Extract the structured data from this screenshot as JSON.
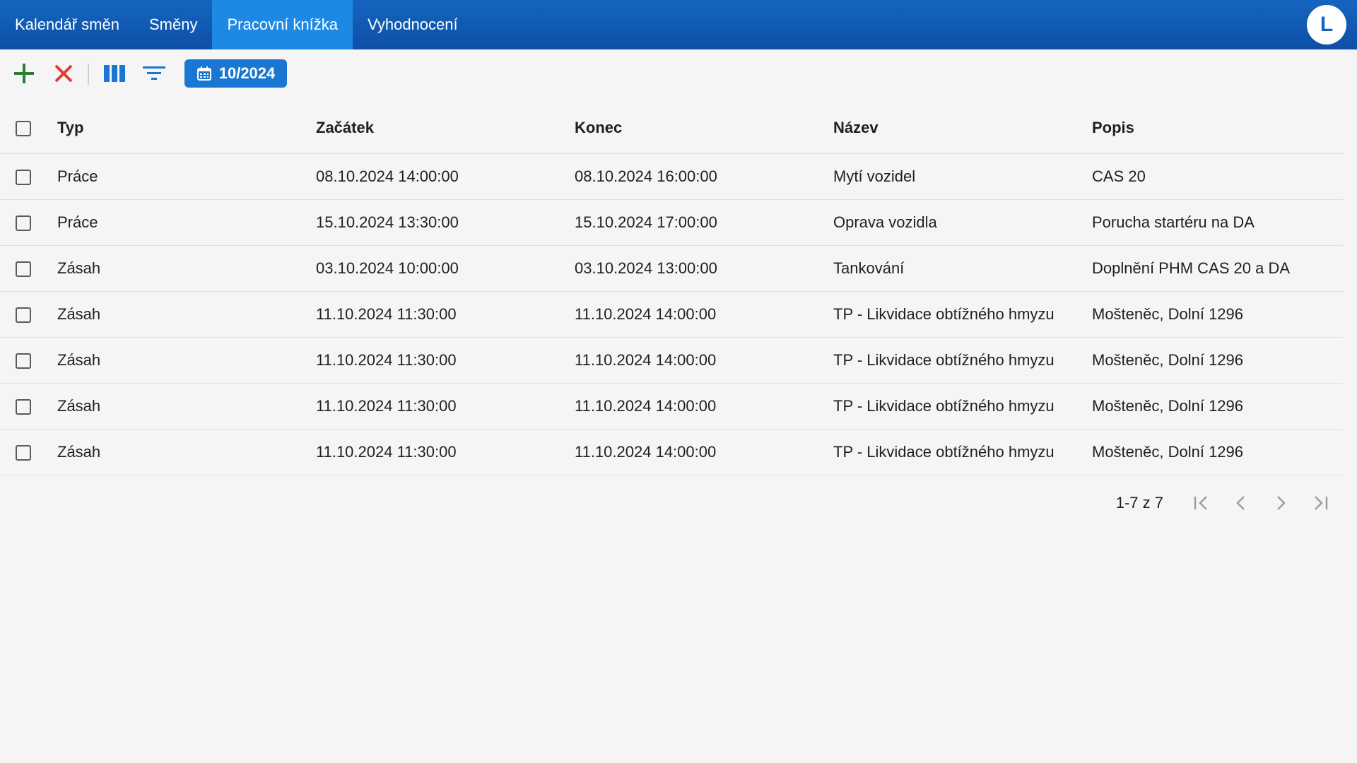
{
  "nav": {
    "tabs": [
      {
        "label": "Kalendář směn"
      },
      {
        "label": "Směny"
      },
      {
        "label": "Pracovní knížka"
      },
      {
        "label": "Vyhodnocení"
      }
    ],
    "active_tab": "Pracovní knížka",
    "avatar_initial": "L"
  },
  "toolbar": {
    "add_icon": "plus-icon",
    "delete_icon": "close-icon",
    "columns_icon": "columns-icon",
    "filter_icon": "filter-icon",
    "period_icon": "calendar-icon",
    "period_label": "10/2024"
  },
  "table": {
    "headers": {
      "type": "Typ",
      "start": "Začátek",
      "end": "Konec",
      "name": "Název",
      "description": "Popis"
    },
    "rows": [
      {
        "type": "Práce",
        "start": "08.10.2024 14:00:00",
        "end": "08.10.2024 16:00:00",
        "name": "Mytí vozidel",
        "description": "CAS 20"
      },
      {
        "type": "Práce",
        "start": "15.10.2024 13:30:00",
        "end": "15.10.2024 17:00:00",
        "name": "Oprava vozidla",
        "description": "Porucha startéru na DA"
      },
      {
        "type": "Zásah",
        "start": "03.10.2024 10:00:00",
        "end": "03.10.2024 13:00:00",
        "name": "Tankování",
        "description": "Doplnění PHM CAS 20 a DA"
      },
      {
        "type": "Zásah",
        "start": "11.10.2024 11:30:00",
        "end": "11.10.2024 14:00:00",
        "name": "TP - Likvidace obtížného hmyzu",
        "description": "Mošteněc, Dolní 1296"
      },
      {
        "type": "Zásah",
        "start": "11.10.2024 11:30:00",
        "end": "11.10.2024 14:00:00",
        "name": "TP - Likvidace obtížného hmyzu",
        "description": "Mošteněc, Dolní 1296"
      },
      {
        "type": "Zásah",
        "start": "11.10.2024 11:30:00",
        "end": "11.10.2024 14:00:00",
        "name": "TP - Likvidace obtížného hmyzu",
        "description": "Mošteněc, Dolní 1296"
      },
      {
        "type": "Zásah",
        "start": "11.10.2024 11:30:00",
        "end": "11.10.2024 14:00:00",
        "name": "TP - Likvidace obtížného hmyzu",
        "description": "Mošteněc, Dolní 1296"
      }
    ]
  },
  "pagination": {
    "range_label": "1-7 z 7",
    "first_icon": "first-page-icon",
    "prev_icon": "chevron-left-icon",
    "next_icon": "chevron-right-icon",
    "last_icon": "last-page-icon"
  },
  "colors": {
    "header_bg": "#1565c0",
    "active_tab_bg": "#1e88e5",
    "accent": "#1976d2",
    "add_green": "#2e7d32",
    "delete_red": "#e53935"
  }
}
